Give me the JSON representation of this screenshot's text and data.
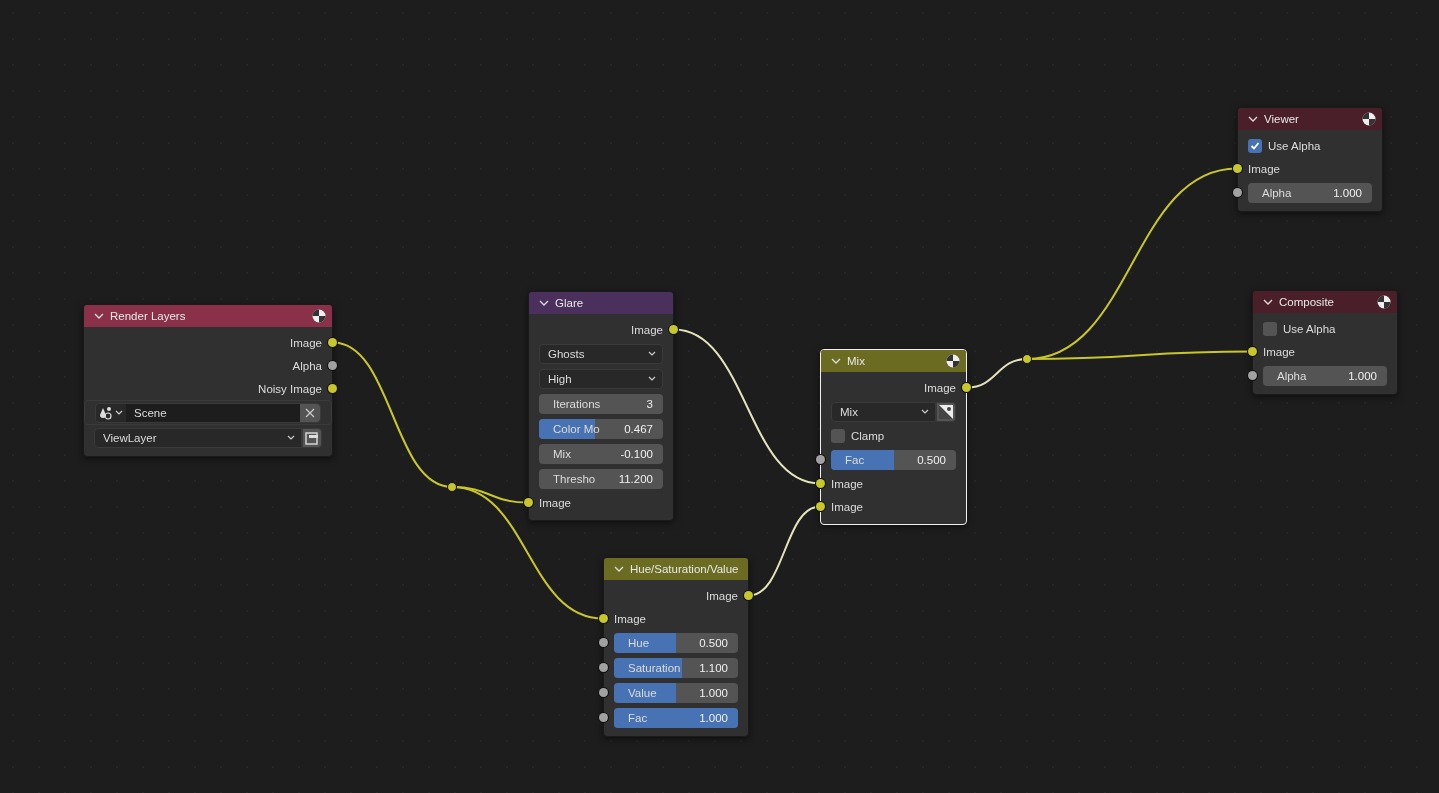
{
  "nodes": [
    {
      "title": "Render Layers",
      "color": "#8a3049",
      "selected": false,
      "preview_icon": true,
      "rows": [
        {
          "kind": "output",
          "label": "Image",
          "color": "#c7c729"
        },
        {
          "kind": "output",
          "label": "Alpha",
          "color": "#a1a1a1"
        },
        {
          "kind": "output",
          "label": "Noisy Image",
          "color": "#c7c729"
        },
        {
          "kind": "scene",
          "value": "Scene"
        },
        {
          "kind": "viewlayer",
          "value": "ViewLayer"
        }
      ]
    },
    {
      "title": "Glare",
      "color": "#4b2f5c",
      "selected": false,
      "preview_icon": false,
      "rows": [
        {
          "kind": "output",
          "label": "Image",
          "color": "#c7c729"
        },
        {
          "kind": "dropdown",
          "value": "Ghosts"
        },
        {
          "kind": "dropdown",
          "value": "High"
        },
        {
          "kind": "field",
          "label": "Iterations",
          "value": "3"
        },
        {
          "kind": "slider",
          "label": "Color Mo",
          "value": "0.467",
          "level": 0.45
        },
        {
          "kind": "field",
          "label": "Mix",
          "value": "-0.100"
        },
        {
          "kind": "field",
          "label": "Thresho",
          "value": "11.200"
        },
        {
          "kind": "input",
          "label": "Image",
          "color": "#c7c729"
        }
      ]
    },
    {
      "title": "Hue/Saturation/Value",
      "color": "#6b6b22",
      "selected": false,
      "preview_icon": false,
      "rows": [
        {
          "kind": "output",
          "label": "Image",
          "color": "#c7c729"
        },
        {
          "kind": "input",
          "label": "Image",
          "color": "#c7c729"
        },
        {
          "kind": "slider",
          "label": "Hue",
          "value": "0.500",
          "level": 0.5,
          "color": "#a1a1a1"
        },
        {
          "kind": "slider",
          "label": "Saturation",
          "value": "1.100",
          "level": 0.55,
          "color": "#a1a1a1"
        },
        {
          "kind": "slider",
          "label": "Value",
          "value": "1.000",
          "level": 0.5,
          "color": "#a1a1a1"
        },
        {
          "kind": "slider",
          "label": "Fac",
          "value": "1.000",
          "level": 1,
          "color": "#a1a1a1"
        }
      ]
    },
    {
      "title": "Mix",
      "color": "#6b6b22",
      "selected": true,
      "preview_icon": true,
      "rows": [
        {
          "kind": "output",
          "label": "Image",
          "color": "#c7c729"
        },
        {
          "kind": "blend",
          "value": "Mix"
        },
        {
          "kind": "checkbox",
          "label": "Clamp",
          "checked": false
        },
        {
          "kind": "slider",
          "label": "Fac",
          "value": "0.500",
          "level": 0.5,
          "color": "#a1a1a1"
        },
        {
          "kind": "input",
          "label": "Image",
          "color": "#c7c729"
        },
        {
          "kind": "input",
          "label": "Image",
          "color": "#c7c729"
        }
      ]
    },
    {
      "title": "Viewer",
      "color": "#4a1f29",
      "selected": false,
      "preview_icon": true,
      "rows": [
        {
          "kind": "checkbox",
          "label": "Use Alpha",
          "checked": true
        },
        {
          "kind": "input",
          "label": "Image",
          "color": "#c7c729"
        },
        {
          "kind": "field",
          "label": "Alpha",
          "value": "1.000",
          "color": "#a1a1a1"
        }
      ]
    },
    {
      "title": "Composite",
      "color": "#4a1f29",
      "selected": false,
      "preview_icon": true,
      "rows": [
        {
          "kind": "checkbox",
          "label": "Use Alpha",
          "checked": false
        },
        {
          "kind": "input",
          "label": "Image",
          "color": "#c7c729"
        },
        {
          "kind": "field",
          "label": "Alpha",
          "value": "1.000",
          "color": "#a1a1a1"
        }
      ]
    }
  ]
}
